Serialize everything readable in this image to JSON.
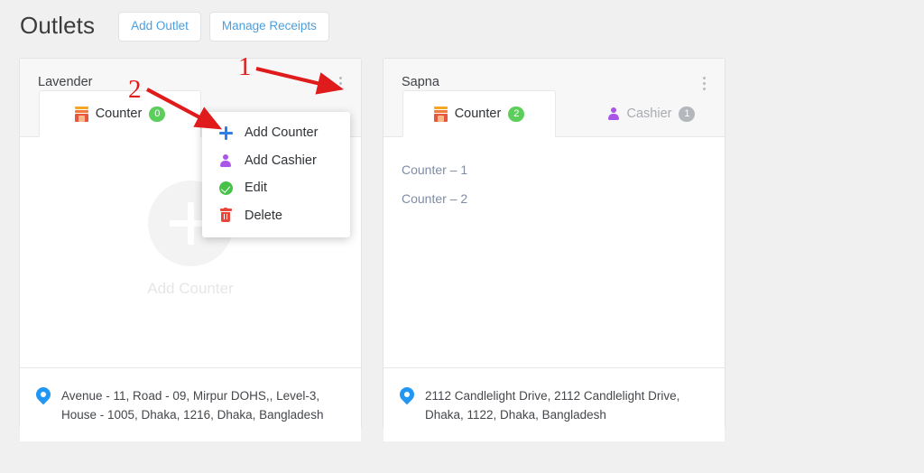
{
  "header": {
    "title": "Outlets",
    "buttons": [
      {
        "label": "Add Outlet",
        "name": "add-outlet-button"
      },
      {
        "label": "Manage Receipts",
        "name": "manage-receipts-button"
      }
    ]
  },
  "colors": {
    "page_background": "#f0f0f0",
    "card_background": "#ffffff",
    "link_blue": "#4a9fe0",
    "badge_green": "#5cce5c",
    "badge_gray": "#b4b7bb",
    "annotation_red": "#e01b1b",
    "counter_link": "#7f8ca3",
    "pin_blue": "#2196f3",
    "plus_blue": "#2f7fe8",
    "person_purple": "#a855e8",
    "edit_green": "#46c346",
    "delete_red": "#e8483c"
  },
  "cards": [
    {
      "name": "Lavender",
      "menu_icon": "kebab-menu-icon",
      "tabs": [
        {
          "label": "Counter",
          "badge": "0",
          "icon": "counter-desk-icon",
          "active": true
        }
      ],
      "empty_state": {
        "icon": "plus-circle-icon",
        "label": "Add Counter"
      },
      "counters": [],
      "address": {
        "icon": "location-pin-icon",
        "text": "Avenue - 11, Road - 09, Mirpur DOHS,, Level-3, House - 1005, Dhaka, 1216, Dhaka, Bangladesh"
      }
    },
    {
      "name": "Sapna",
      "menu_icon": "kebab-menu-icon",
      "tabs": [
        {
          "label": "Counter",
          "badge": "2",
          "icon": "counter-desk-icon",
          "active": true
        },
        {
          "label": "Cashier",
          "badge": "1",
          "icon": "person-icon",
          "active": false
        }
      ],
      "counters": [
        {
          "label": "Counter  – 1"
        },
        {
          "label": "Counter  – 2"
        }
      ],
      "address": {
        "icon": "location-pin-icon",
        "text": "2112 Candlelight Drive, 2112 Candlelight Drive, Dhaka, 1122, Dhaka, Bangladesh"
      }
    }
  ],
  "dropdown": {
    "visible": true,
    "items": [
      {
        "label": "Add Counter",
        "icon": "plus-icon"
      },
      {
        "label": "Add Cashier",
        "icon": "person-icon"
      },
      {
        "label": "Edit",
        "icon": "check-circle-icon"
      },
      {
        "label": "Delete",
        "icon": "trash-icon"
      }
    ]
  },
  "annotations": [
    {
      "number": "1",
      "points_to": "kebab-menu-icon"
    },
    {
      "number": "2",
      "points_to": "menu-item-add-counter"
    }
  ]
}
